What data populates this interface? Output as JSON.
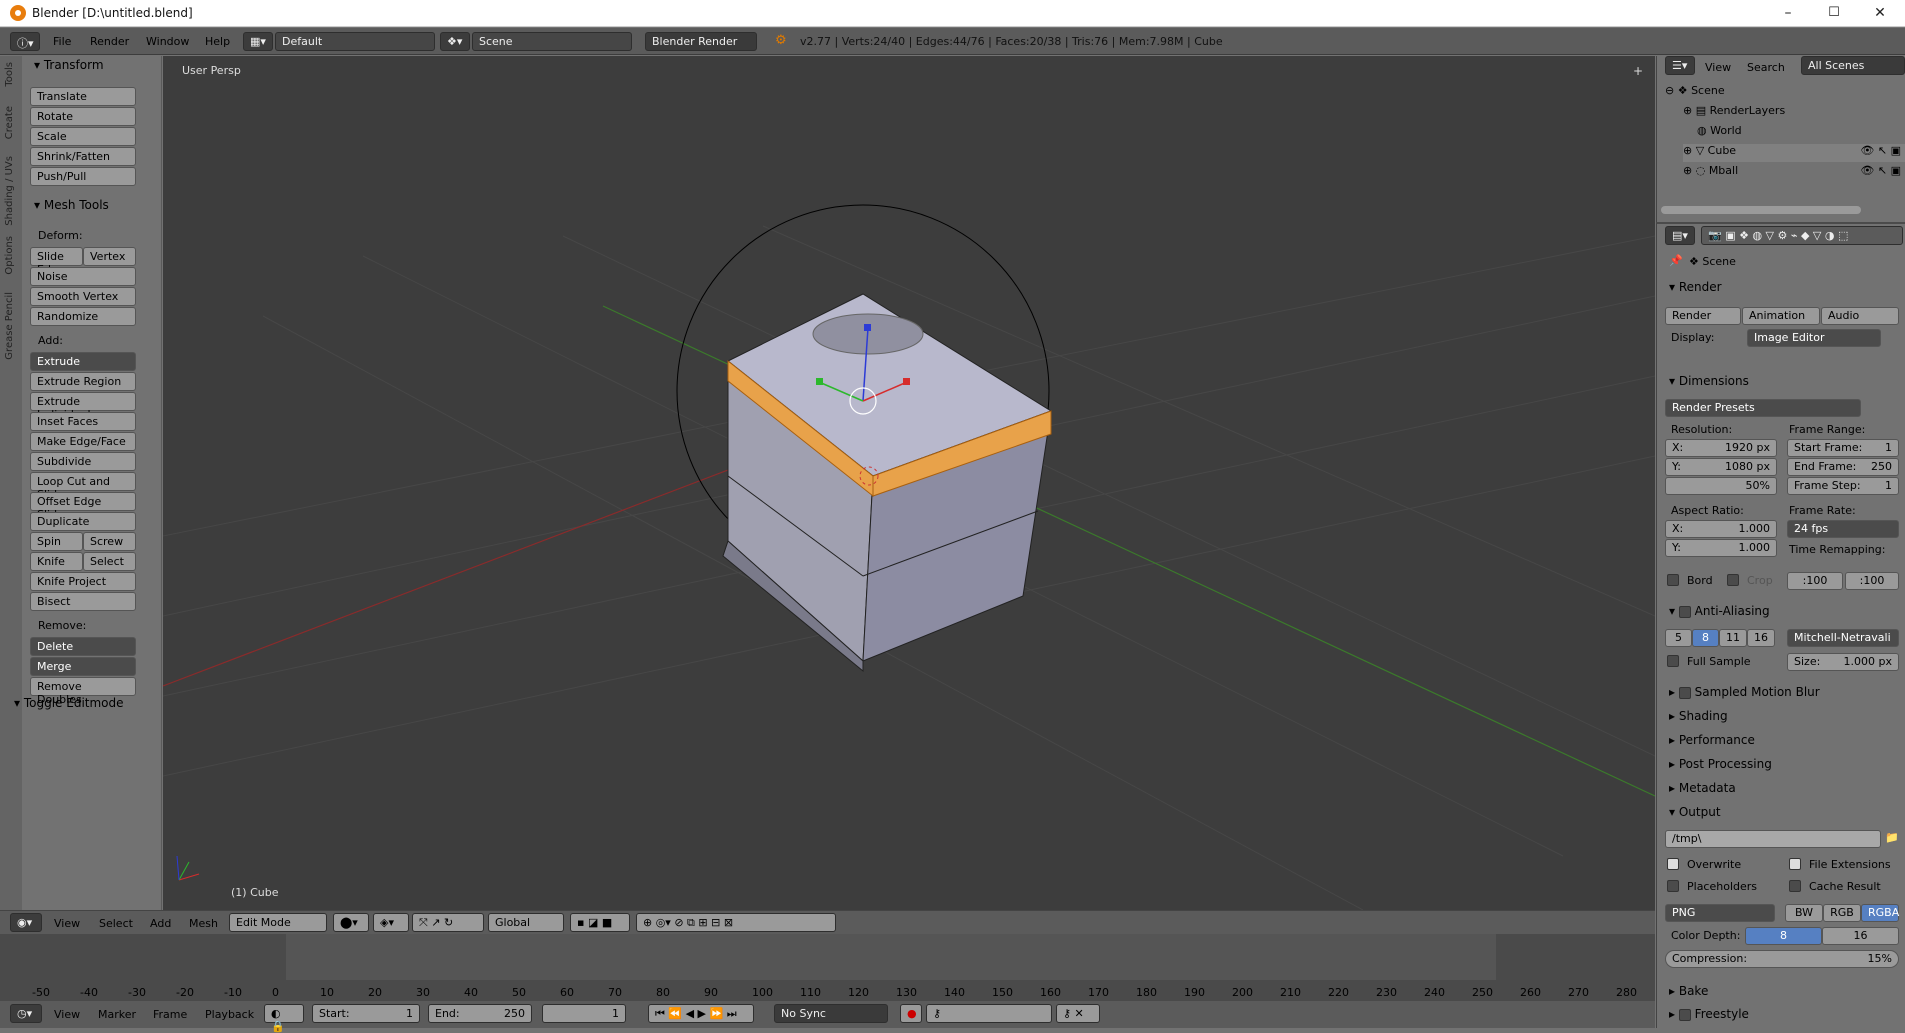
{
  "window": {
    "title": "Blender [D:\\untitled.blend]",
    "min": "–",
    "max": "☐",
    "close": "✕"
  },
  "menubar": {
    "items": [
      "File",
      "Render",
      "Window",
      "Help"
    ],
    "layout": "Default",
    "scene": "Scene",
    "engine": "Blender Render",
    "stats": "v2.77 | Verts:24/40 | Edges:44/76 | Faces:20/38 | Tris:76 | Mem:7.98M | Cube"
  },
  "toolshelf": {
    "tabs": [
      "Tools",
      "Create",
      "Shading / UVs",
      "Options",
      "Grease Pencil"
    ],
    "transform": {
      "title": "Transform",
      "buttons": [
        "Translate",
        "Rotate",
        "Scale",
        "Shrink/Fatten",
        "Push/Pull"
      ]
    },
    "mesh_tools": {
      "title": "Mesh Tools",
      "deform_label": "Deform:",
      "deform_row": [
        "Slide Ed",
        "Vertex"
      ],
      "deform": [
        "Noise",
        "Smooth Vertex",
        "Randomize"
      ],
      "add_label": "Add:",
      "extrude": "Extrude",
      "add": [
        "Extrude Region",
        "Extrude Individual",
        "Inset Faces",
        "Make Edge/Face",
        "Subdivide",
        "Loop Cut and Slide",
        "Offset Edge Slide",
        "Duplicate"
      ],
      "spin": [
        "Spin",
        "Screw"
      ],
      "knife": [
        "Knife",
        "Select"
      ],
      "add2": [
        "Knife Project",
        "Bisect"
      ],
      "remove_label": "Remove:",
      "delete": "Delete",
      "merge": "Merge",
      "remove_doubles": "Remove Doubles"
    },
    "toggle": "Toggle Editmode"
  },
  "viewport": {
    "persp": "User Persp",
    "object": "(1) Cube"
  },
  "view_header": {
    "items": [
      "View",
      "Select",
      "Add",
      "Mesh"
    ],
    "mode": "Edit Mode",
    "orientation": "Global"
  },
  "timeline": {
    "ticks": [
      "-50",
      "-40",
      "-30",
      "-20",
      "-10",
      "0",
      "10",
      "20",
      "30",
      "40",
      "50",
      "60",
      "70",
      "80",
      "90",
      "100",
      "110",
      "120",
      "130",
      "140",
      "150",
      "160",
      "170",
      "180",
      "190",
      "200",
      "210",
      "220",
      "230",
      "240",
      "250",
      "260",
      "270",
      "280"
    ],
    "menu": [
      "View",
      "Marker",
      "Frame",
      "Playback"
    ],
    "start_label": "Start:",
    "start": "1",
    "end_label": "End:",
    "end": "250",
    "current": "1",
    "sync": "No Sync"
  },
  "outliner": {
    "view": "View",
    "search": "Search",
    "filter": "All Scenes",
    "items": [
      "Scene",
      "RenderLayers",
      "World",
      "Cube",
      "Mball"
    ]
  },
  "properties": {
    "context": "Scene",
    "render": {
      "title": "Render",
      "buttons": [
        "Render",
        "Animation",
        "Audio"
      ],
      "display_label": "Display:",
      "display": "Image Editor"
    },
    "dimensions": {
      "title": "Dimensions",
      "presets": "Render Presets",
      "resolution_label": "Resolution:",
      "res_x": "X:",
      "res_x_val": "1920 px",
      "res_y": "Y:",
      "res_y_val": "1080 px",
      "res_pct": "50%",
      "frame_range_label": "Frame Range:",
      "start": "Start Frame:",
      "start_val": "1",
      "end": "End Frame:",
      "end_val": "250",
      "step": "Frame Step:",
      "step_val": "1",
      "aspect_label": "Aspect Ratio:",
      "asp_x": "X:",
      "asp_x_val": "1.000",
      "asp_y": "Y:",
      "asp_y_val": "1.000",
      "frame_rate_label": "Frame Rate:",
      "fps": "24 fps",
      "time_remap": "Time Remapping:",
      "remap_old": ":100",
      "remap_new": ":100",
      "bord": "Bord",
      "crop": "Crop"
    },
    "aa": {
      "title": "Anti-Aliasing",
      "samples": [
        "5",
        "8",
        "11",
        "16"
      ],
      "filter": "Mitchell-Netravali",
      "full_sample": "Full Sample",
      "size": "Size:",
      "size_val": "1.000 px"
    },
    "collapsed": [
      "Sampled Motion Blur",
      "Shading",
      "Performance",
      "Post Processing",
      "Metadata"
    ],
    "output": {
      "title": "Output",
      "path": "/tmp\\",
      "overwrite": "Overwrite",
      "file_ext": "File Extensions",
      "placeholders": "Placeholders",
      "cache": "Cache Result",
      "format": "PNG",
      "bw": "BW",
      "rgb": "RGB",
      "rgba": "RGBA",
      "depth_label": "Color Depth:",
      "d8": "8",
      "d16": "16",
      "compression": "Compression:",
      "comp_val": "15%"
    },
    "bake": "Bake",
    "freestyle": "Freestyle"
  }
}
